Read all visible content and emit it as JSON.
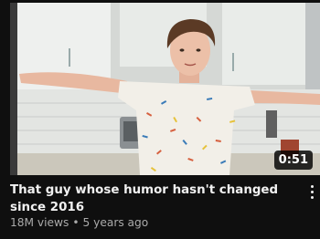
{
  "video": {
    "title": "That guy whose humor hasn't changed since 2016",
    "duration": "0:51",
    "views": "18M views",
    "separator": "•",
    "age": "5 years ago"
  },
  "menu": {
    "icon": "more-vert-icon"
  },
  "colors": {
    "background": "#0f0f0f",
    "title": "#f1f1f1",
    "meta": "#aaaaaa",
    "duration_bg": "#000000"
  }
}
